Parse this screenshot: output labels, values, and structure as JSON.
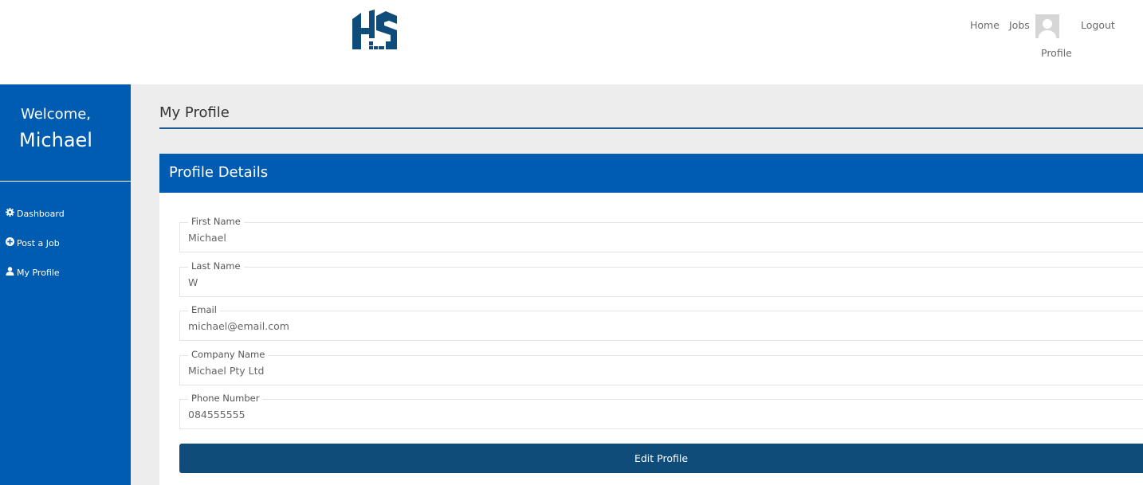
{
  "brand": {
    "logo_icon": "hs-logo-icon",
    "colors": {
      "primary": "#005cb0",
      "button": "#0f4c7a",
      "rule": "#1e5d94",
      "background": "#ededed"
    }
  },
  "nav": {
    "home_label": "Home",
    "jobs_label": "Jobs",
    "profile_label": "Profile",
    "logout_label": "Logout",
    "avatar_icon": "user-avatar-icon"
  },
  "sidebar": {
    "welcome_label": "Welcome,",
    "user_name": "Michael",
    "items": [
      {
        "label": "Dashboard",
        "icon": "gear-icon"
      },
      {
        "label": "Post a Job",
        "icon": "plus-circle-icon"
      },
      {
        "label": "My Profile",
        "icon": "user-icon"
      }
    ]
  },
  "main": {
    "page_title": "My Profile",
    "card_title": "Profile Details",
    "fields": [
      {
        "label": "First Name",
        "value": "Michael"
      },
      {
        "label": "Last Name",
        "value": "W"
      },
      {
        "label": "Email",
        "value": "michael@email.com"
      },
      {
        "label": "Company Name",
        "value": "Michael Pty Ltd"
      },
      {
        "label": "Phone Number",
        "value": "084555555"
      }
    ],
    "edit_button_label": "Edit Profile"
  }
}
